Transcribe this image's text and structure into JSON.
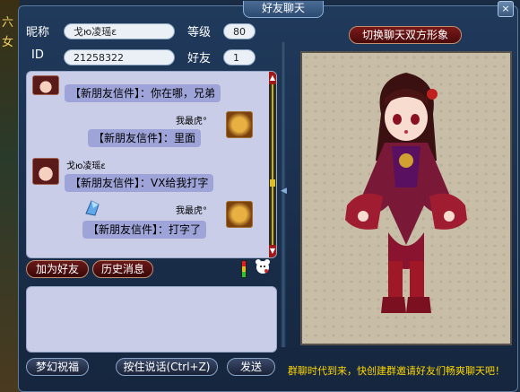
{
  "window": {
    "title": "好友聊天",
    "close": "×"
  },
  "background": {
    "chars": [
      "六",
      "女"
    ]
  },
  "profile": {
    "nickname_label": "昵称",
    "nickname": "戈ю凌瑶ε",
    "level_label": "等级",
    "level": "80",
    "id_label": "ID",
    "id": "21258322",
    "friendship_label": "好友",
    "friendship": "1"
  },
  "switch_button": "切换聊天双方形象",
  "messages": [
    {
      "sender": "",
      "text": "【新朋友信件】：你在哪，兄弟",
      "side": "left"
    },
    {
      "sender": "我最虎°",
      "text": "【新朋友信件】：里面",
      "side": "right"
    },
    {
      "sender": "戈ю凌瑶ε",
      "text": "【新朋友信件】：VX给我打字",
      "side": "left"
    },
    {
      "sender": "我最虎°",
      "text": "【新朋友信件】：打字了",
      "side": "right"
    }
  ],
  "actions": {
    "add_friend": "加为好友",
    "history": "历史消息"
  },
  "bottom": {
    "dream_wish": "梦幻祝福",
    "hold_talk": "按住说话(Ctrl+Z)",
    "send": "发送"
  },
  "footer_notice": "群聊时代到来，快创建群邀请好友们畅爽聊天吧！",
  "colors": {
    "accent_red": "#7a1a1a",
    "gold": "#ffd700",
    "panel": "#c9cde8"
  },
  "icons": {
    "scroll_up": "▲",
    "scroll_down": "▼",
    "side_toggle": "◀"
  }
}
